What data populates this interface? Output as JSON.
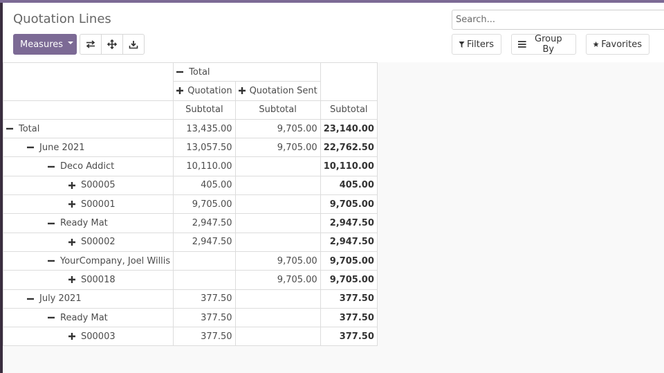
{
  "app": {
    "accent_color": "#7c6a95"
  },
  "control_panel": {
    "title": "Quotation Lines",
    "measures_label": "Measures",
    "icon_buttons": [
      "flip-axis-icon",
      "expand-all-icon",
      "download-icon"
    ],
    "search_placeholder": "Search...",
    "filters_label": "Filters",
    "group_by_label": "Group By",
    "favorites_label": "Favorites"
  },
  "pivot": {
    "col_total_label": "Total",
    "col_groups": [
      "Quotation",
      "Quotation Sent"
    ],
    "measure_label": "Subtotal",
    "rows": [
      {
        "level": 0,
        "toggle": "collapse",
        "label": "Total",
        "values": [
          "13,435.00",
          "9,705.00",
          "23,140.00"
        ],
        "bold": true
      },
      {
        "level": 1,
        "toggle": "collapse",
        "label": "June 2021",
        "values": [
          "13,057.50",
          "9,705.00",
          "22,762.50"
        ]
      },
      {
        "level": 2,
        "toggle": "collapse",
        "label": "Deco Addict",
        "values": [
          "10,110.00",
          "",
          "10,110.00"
        ]
      },
      {
        "level": 3,
        "toggle": "expand",
        "label": "S00005",
        "values": [
          "405.00",
          "",
          "405.00"
        ]
      },
      {
        "level": 3,
        "toggle": "expand",
        "label": "S00001",
        "values": [
          "9,705.00",
          "",
          "9,705.00"
        ]
      },
      {
        "level": 2,
        "toggle": "collapse",
        "label": "Ready Mat",
        "values": [
          "2,947.50",
          "",
          "2,947.50"
        ]
      },
      {
        "level": 3,
        "toggle": "expand",
        "label": "S00002",
        "values": [
          "2,947.50",
          "",
          "2,947.50"
        ]
      },
      {
        "level": 2,
        "toggle": "collapse",
        "label": "YourCompany, Joel Willis",
        "values": [
          "",
          "9,705.00",
          "9,705.00"
        ]
      },
      {
        "level": 3,
        "toggle": "expand",
        "label": "S00018",
        "values": [
          "",
          "9,705.00",
          "9,705.00"
        ]
      },
      {
        "level": 1,
        "toggle": "collapse",
        "label": "July 2021",
        "values": [
          "377.50",
          "",
          "377.50"
        ]
      },
      {
        "level": 2,
        "toggle": "collapse",
        "label": "Ready Mat",
        "values": [
          "377.50",
          "",
          "377.50"
        ]
      },
      {
        "level": 3,
        "toggle": "expand",
        "label": "S00003",
        "values": [
          "377.50",
          "",
          "377.50"
        ]
      }
    ]
  }
}
